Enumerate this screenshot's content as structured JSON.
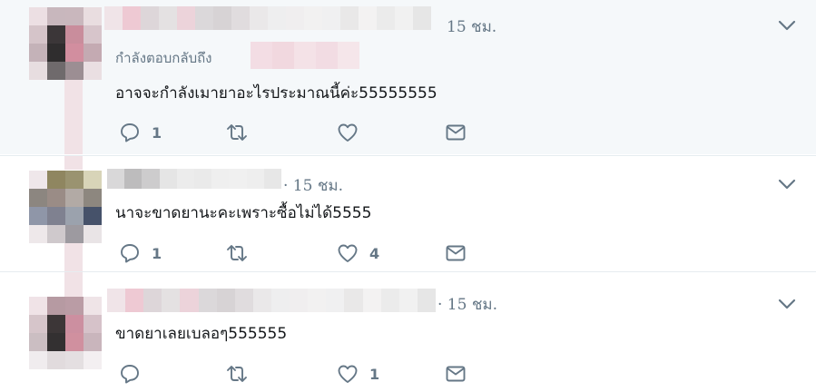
{
  "tweets": [
    {
      "time": "15 ชม.",
      "replying_label": "กำลังตอบกลับถึง",
      "text": "อาจจะกำลังเมายาอะไรประมาณนี้ค่ะ55555555",
      "reply_count": "1",
      "retweet_count": "",
      "like_count": ""
    },
    {
      "time": "· 15 ชม.",
      "text": "นาจะขาดยานะคะเพราะซื้อไม่ได้5555",
      "reply_count": "1",
      "retweet_count": "",
      "like_count": "4"
    },
    {
      "time": "· 15 ชม.",
      "text": "ขาดยาเลยเบลอๆ555555",
      "reply_count": "",
      "retweet_count": "",
      "like_count": "1"
    }
  ],
  "icons": {
    "reply": "reply-icon",
    "retweet": "retweet-icon",
    "like": "heart-icon",
    "dm": "mail-icon",
    "menu": "chevron-down-icon"
  },
  "colors": {
    "icon": "#657786",
    "text": "#14171a",
    "muted": "#657786",
    "highlight_bg": "#f5f8fa"
  }
}
